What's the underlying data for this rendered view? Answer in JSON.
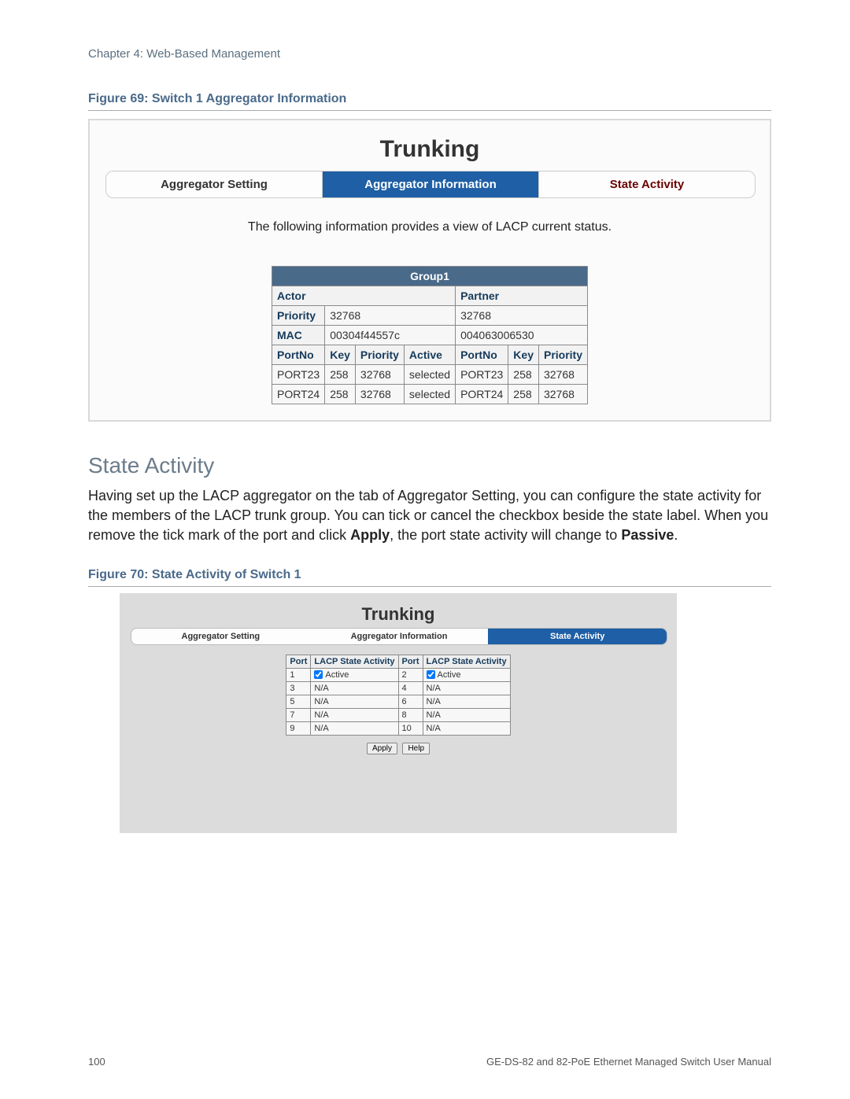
{
  "chapter": "Chapter 4: Web-Based Management",
  "figure69": {
    "caption": "Figure 69: Switch 1 Aggregator Information",
    "title": "Trunking",
    "tabs": {
      "left": "Aggregator Setting",
      "active": "Aggregator Information",
      "right": "State Activity"
    },
    "info_text": "The following information provides a view of LACP current status.",
    "group_label": "Group1",
    "actor_label": "Actor",
    "partner_label": "Partner",
    "priority_label": "Priority",
    "mac_label": "MAC",
    "actor_priority": "32768",
    "partner_priority": "32768",
    "actor_mac": "00304f44557c",
    "partner_mac": "004063006530",
    "actor_headers": {
      "portno": "PortNo",
      "key": "Key",
      "priority": "Priority",
      "active": "Active"
    },
    "partner_headers": {
      "portno": "PortNo",
      "key": "Key",
      "priority": "Priority"
    },
    "rows": [
      {
        "a_port": "PORT23",
        "a_key": "258",
        "a_prio": "32768",
        "a_active": "selected",
        "p_port": "PORT23",
        "p_key": "258",
        "p_prio": "32768"
      },
      {
        "a_port": "PORT24",
        "a_key": "258",
        "a_prio": "32768",
        "a_active": "selected",
        "p_port": "PORT24",
        "p_key": "258",
        "p_prio": "32768"
      }
    ]
  },
  "section": {
    "title": "State Activity",
    "p1a": "Having set up the LACP aggregator on the tab of Aggregator Setting, you can configure the state activity for the members of the LACP trunk group. You can tick or cancel the checkbox beside the state label. When you remove the tick mark of the port and click ",
    "p1b": "Apply",
    "p1c": ", the port state activity will change to ",
    "p1d": "Passive",
    "p1e": "."
  },
  "figure70": {
    "caption": "Figure 70: State Activity of Switch 1",
    "title": "Trunking",
    "tabs": {
      "left": "Aggregator Setting",
      "mid": "Aggregator Information",
      "active": "State Activity"
    },
    "headers": {
      "port": "Port",
      "act": "LACP State Activity"
    },
    "active_label": "Active",
    "na": "N/A",
    "rows": [
      {
        "p1": "1",
        "v1": "check",
        "p2": "2",
        "v2": "check"
      },
      {
        "p1": "3",
        "v1": "na",
        "p2": "4",
        "v2": "na"
      },
      {
        "p1": "5",
        "v1": "na",
        "p2": "6",
        "v2": "na"
      },
      {
        "p1": "7",
        "v1": "na",
        "p2": "8",
        "v2": "na"
      },
      {
        "p1": "9",
        "v1": "na",
        "p2": "10",
        "v2": "na"
      }
    ],
    "apply": "Apply",
    "help": "Help"
  },
  "footer": {
    "page": "100",
    "manual": "GE-DS-82 and 82-PoE Ethernet Managed Switch User Manual"
  }
}
